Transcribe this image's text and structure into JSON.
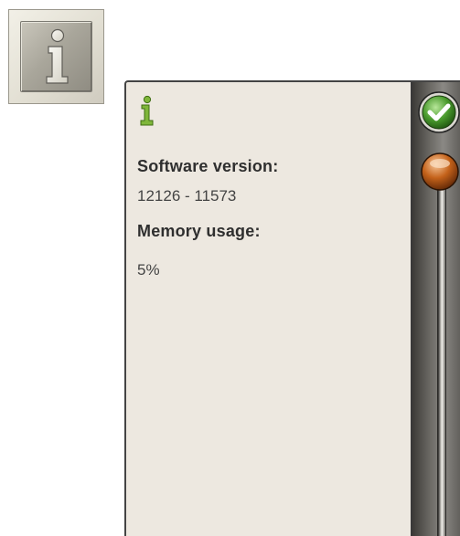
{
  "panel": {
    "software_version_label": "Software version:",
    "software_version_value": "12126 - 11573",
    "memory_usage_label": "Memory usage:",
    "memory_usage_value": "5%"
  },
  "icons": {
    "info_button": "info-icon",
    "panel_header": "info-icon",
    "ok_button": "checkmark-icon",
    "scroll_thumb": "scroll-thumb"
  },
  "colors": {
    "panel_background": "#ede8e0",
    "info_icon_green": "#5a8e1f",
    "ok_green": "#4a9a2d",
    "scroll_thumb_orange": "#c4621a"
  }
}
